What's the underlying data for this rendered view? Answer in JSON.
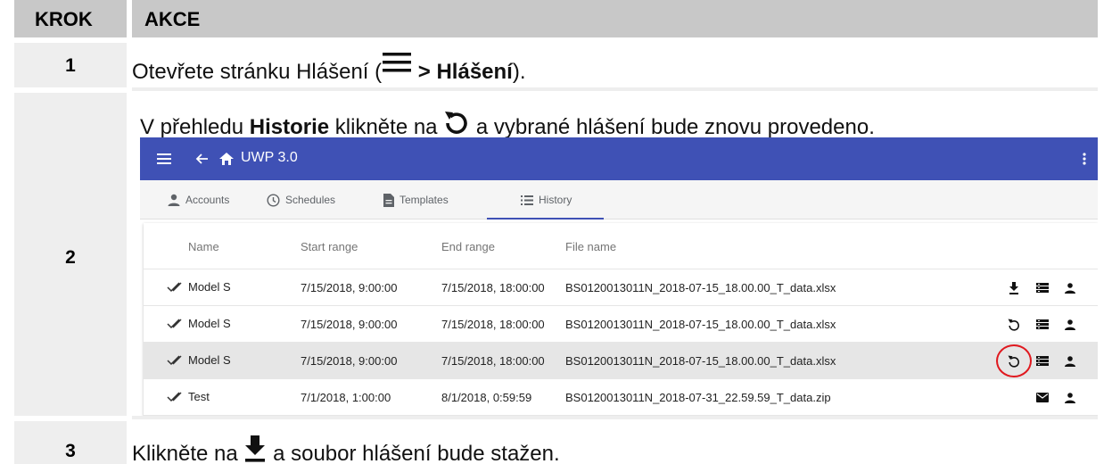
{
  "table": {
    "header_step": "KROK",
    "header_action": "AKCE"
  },
  "steps": [
    {
      "number": "1",
      "text_before": "Otevřete stránku Hlášení (",
      "text_bold": " > Hlášení",
      "text_after": ")."
    },
    {
      "number": "2",
      "text_before": "V přehledu ",
      "text_bold": "Historie",
      "text_middle": " klikněte na ",
      "text_after": " a vybrané hlášení bude znovu provedeno."
    },
    {
      "number": "3",
      "text_before": "Klikněte na ",
      "text_after": " a soubor hlášení bude stažen."
    }
  ],
  "app": {
    "title": "UWP 3.0",
    "colors": {
      "appbar": "#3f51b5",
      "selected_row": "#e6e6e6",
      "highlight_circle": "#e0191f"
    },
    "tabs": [
      {
        "label": "Accounts",
        "icon": "person-icon"
      },
      {
        "label": "Schedules",
        "icon": "clock-icon"
      },
      {
        "label": "Templates",
        "icon": "document-icon"
      },
      {
        "label": "History",
        "icon": "list-icon",
        "active": true
      }
    ],
    "columns": [
      "Name",
      "Start range",
      "End range",
      "File name"
    ],
    "rows": [
      {
        "name": "Model S",
        "start": "7/15/2018, 9:00:00",
        "end": "7/15/2018, 18:00:00",
        "file": "BS0120013011N_2018-07-15_18.00.00_T_data.xlsx",
        "actions": [
          "download-icon",
          "details-icon",
          "person-icon"
        ]
      },
      {
        "name": "Model S",
        "start": "7/15/2018, 9:00:00",
        "end": "7/15/2018, 18:00:00",
        "file": "BS0120013011N_2018-07-15_18.00.00_T_data.xlsx",
        "actions": [
          "rerun-icon",
          "details-icon",
          "person-icon"
        ]
      },
      {
        "name": "Model S",
        "start": "7/15/2018, 9:00:00",
        "end": "7/15/2018, 18:00:00",
        "file": "BS0120013011N_2018-07-15_18.00.00_T_data.xlsx",
        "actions": [
          "rerun-icon",
          "details-icon",
          "person-icon"
        ],
        "selected": true
      },
      {
        "name": "Test",
        "start": "7/1/2018, 1:00:00",
        "end": "8/1/2018, 0:59:59",
        "file": "BS0120013011N_2018-07-31_22.59.59_T_data.zip",
        "actions": [
          "mail-icon",
          "person-icon"
        ]
      }
    ]
  }
}
